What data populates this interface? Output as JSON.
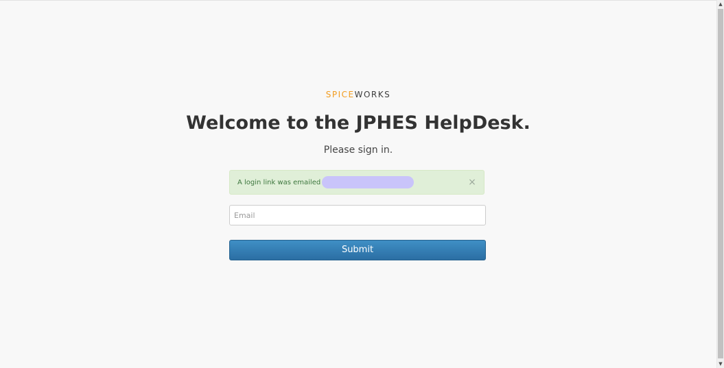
{
  "logo": {
    "spice": "SPICE",
    "works": "WORKS"
  },
  "header": {
    "title": "Welcome to the JPHES HelpDesk.",
    "subtitle": "Please sign in."
  },
  "alert": {
    "message": "A login link was emailed to",
    "close_glyph": "×",
    "color": "#e0efd8"
  },
  "form": {
    "email_placeholder": "Email",
    "email_value": "",
    "submit_label": "Submit",
    "submit_color": "#3380b8"
  },
  "scrollbar": {
    "up_glyph": "▲",
    "down_glyph": "▼"
  }
}
